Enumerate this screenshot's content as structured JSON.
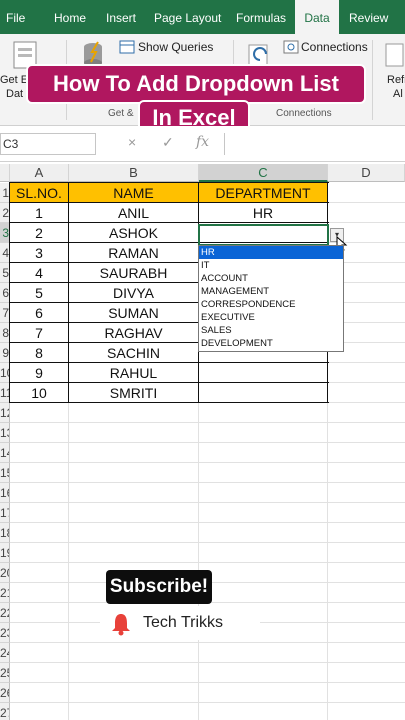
{
  "ribbon_tabs": [
    {
      "label": "File"
    },
    {
      "label": "Home"
    },
    {
      "label": "Insert"
    },
    {
      "label": "Page Layout"
    },
    {
      "label": "Formulas"
    },
    {
      "label": "Data"
    },
    {
      "label": "Review"
    }
  ],
  "ribbon": {
    "get_external_line1": "Get Ex",
    "get_external_line2": "Dat",
    "show_queries": "Show Queries",
    "connections": "Connections",
    "group_get": "Get &",
    "group_connections": "Connections",
    "refresh_line1": "Refr",
    "refresh_line2": "Al"
  },
  "banner": {
    "line1": "How To Add Dropdown List",
    "line2": "In Excel"
  },
  "formula_bar": {
    "name_box": "C3",
    "cancel_icon": "×",
    "enter_icon": "✓",
    "fx_icon": "fx"
  },
  "columns": [
    "A",
    "B",
    "C",
    "D"
  ],
  "rows": [
    "1",
    "2",
    "3",
    "4",
    "5",
    "6",
    "7",
    "8",
    "9",
    "10",
    "11",
    "12",
    "13",
    "14",
    "15",
    "16",
    "17",
    "18",
    "19",
    "20",
    "21",
    "22",
    "23",
    "24",
    "25",
    "26",
    "27"
  ],
  "table": {
    "headers": [
      "SL.NO.",
      "NAME",
      "DEPARTMENT"
    ],
    "rows": [
      [
        "1",
        "ANIL",
        "HR"
      ],
      [
        "2",
        "ASHOK",
        ""
      ],
      [
        "3",
        "RAMAN",
        ""
      ],
      [
        "4",
        "SAURABH",
        ""
      ],
      [
        "5",
        "DIVYA",
        ""
      ],
      [
        "6",
        "SUMAN",
        ""
      ],
      [
        "7",
        "RAGHAV",
        ""
      ],
      [
        "8",
        "SACHIN",
        ""
      ],
      [
        "9",
        "RAHUL",
        ""
      ],
      [
        "10",
        "SMRITI",
        ""
      ]
    ]
  },
  "dropdown": {
    "arrow": "▾",
    "options": [
      "HR",
      "IT",
      "ACCOUNT",
      "MANAGEMENT",
      "CORRESPONDENCE",
      "EXECUTIVE",
      "SALES",
      "DEVELOPMENT"
    ],
    "highlighted_index": 0
  },
  "overlay": {
    "subscribe": "Subscribe!",
    "channel": "Tech Trikks",
    "bell_icon": "bell-icon"
  },
  "colors": {
    "excel_green": "#217346",
    "header_fill": "#ffc000",
    "banner": "#b0175f",
    "highlight": "#0a64d6"
  }
}
